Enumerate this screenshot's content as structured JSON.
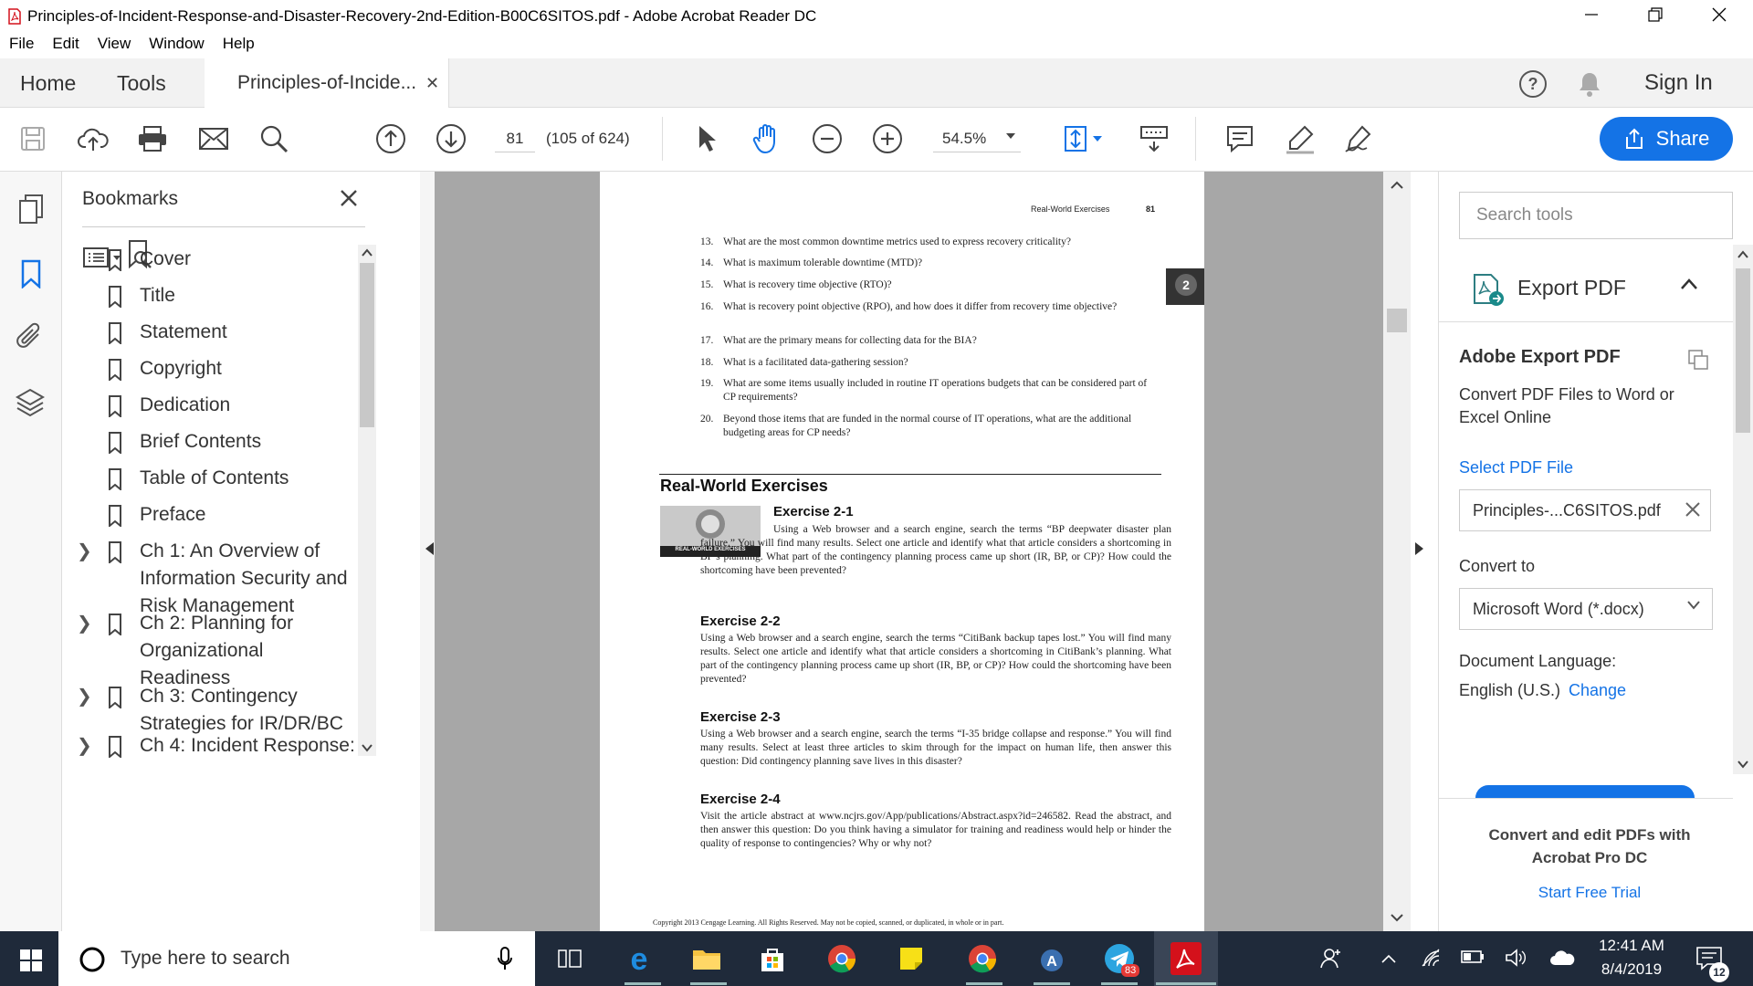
{
  "window": {
    "title": "Principles-of-Incident-Response-and-Disaster-Recovery-2nd-Edition-B00C6SITOS.pdf - Adobe Acrobat Reader DC"
  },
  "menu": [
    "File",
    "Edit",
    "View",
    "Window",
    "Help"
  ],
  "tabs": {
    "home": "Home",
    "tools": "Tools",
    "doc": "Principles-of-Incide...",
    "sign_in": "Sign In"
  },
  "toolbar": {
    "page_number": "81",
    "page_of": "(105 of 624)",
    "zoom": "54.5%",
    "share": "Share"
  },
  "bookmarks": {
    "title": "Bookmarks",
    "items": [
      {
        "label": "Cover",
        "expandable": false
      },
      {
        "label": "Title",
        "expandable": false
      },
      {
        "label": "Statement",
        "expandable": false
      },
      {
        "label": "Copyright",
        "expandable": false
      },
      {
        "label": "Dedication",
        "expandable": false
      },
      {
        "label": "Brief Contents",
        "expandable": false
      },
      {
        "label": "Table of Contents",
        "expandable": false
      },
      {
        "label": "Preface",
        "expandable": false
      },
      {
        "label": "Ch 1: An Overview of Information Security and Risk Management",
        "expandable": true
      },
      {
        "label": "Ch 2: Planning for Organizational Readiness",
        "expandable": true
      },
      {
        "label": "Ch 3: Contingency Strategies for IR/DR/BC",
        "expandable": true
      },
      {
        "label": "Ch 4: Incident Response:",
        "expandable": true
      }
    ]
  },
  "pdf_page": {
    "running_head": "Real-World Exercises",
    "page_no": "81",
    "chapter_badge": "2",
    "questions": [
      {
        "n": "13.",
        "text": "What are the most common downtime metrics used to express recovery criticality?"
      },
      {
        "n": "14.",
        "text": "What is maximum tolerable downtime (MTD)?"
      },
      {
        "n": "15.",
        "text": "What is recovery time objective (RTO)?"
      },
      {
        "n": "16.",
        "text": "What is recovery point objective (RPO), and how does it differ from recovery time objective?"
      },
      {
        "n": "17.",
        "text": "What are the primary means for collecting data for the BIA?"
      },
      {
        "n": "18.",
        "text": "What is a facilitated data-gathering session?"
      },
      {
        "n": "19.",
        "text": "What are some items usually included in routine IT operations budgets that can be considered part of CP requirements?"
      },
      {
        "n": "20.",
        "text": "Beyond those items that are funded in the normal course of IT operations, what are the additional budgeting areas for CP needs?"
      }
    ],
    "section_title": "Real-World Exercises",
    "image_caption": "REAL-WORLD EXERCISES",
    "exercises": [
      {
        "title": "Exercise 2-1",
        "text": "Using a Web browser and a search engine, search the terms “BP deepwater disaster plan failure.” You will find many results. Select one article and identify what that article considers a shortcoming in BP’s planning. What part of the contingency planning process came up short (IR, BP, or CP)? How could the shortcoming have been prevented?"
      },
      {
        "title": "Exercise 2-2",
        "text": "Using a Web browser and a search engine, search the terms “CitiBank backup tapes lost.” You will find many results. Select one article and identify what that article considers a shortcoming in CitiBank’s planning. What part of the contingency planning process came up short (IR, BP, or CP)? How could the shortcoming have been prevented?"
      },
      {
        "title": "Exercise 2-3",
        "text": "Using a Web browser and a search engine, search the terms “I-35 bridge collapse and response.” You will find many results. Select at least three articles to skim through for the impact on human life, then answer this question: Did contingency planning save lives in this disaster?"
      },
      {
        "title": "Exercise 2-4",
        "text": "Visit the article abstract at www.ncjrs.gov/App/publications/Abstract.aspx?id=246582. Read the abstract, and then answer this question: Do you think having a simulator for training and readiness would help or hinder the quality of response to contingencies? Why or why not?"
      }
    ],
    "footer": "Copyright 2013 Cengage Learning. All Rights Reserved. May not be copied, scanned, or duplicated, in whole or in part."
  },
  "tools_panel": {
    "search_placeholder": "Search tools",
    "export_title": "Export PDF",
    "adobe_export": "Adobe Export PDF",
    "desc": "Convert PDF Files to Word or Excel Online",
    "select_file": "Select PDF File",
    "file_name": "Principles-...C6SITOS.pdf",
    "convert_to": "Convert to",
    "format": "Microsoft Word (*.docx)",
    "doc_lang_label": "Document Language:",
    "doc_lang": "English (U.S.)",
    "change": "Change",
    "promo": "Convert and edit PDFs with Acrobat Pro DC",
    "trial": "Start Free Trial"
  },
  "taskbar": {
    "search": "Type here to search",
    "time": "12:41 AM",
    "date": "8/4/2019",
    "notif_count": "12",
    "telegram_badge": "83"
  },
  "colors": {
    "accent": "#1473e6",
    "taskbar": "#1f2a3a",
    "acrobat_red": "#d4111b"
  }
}
